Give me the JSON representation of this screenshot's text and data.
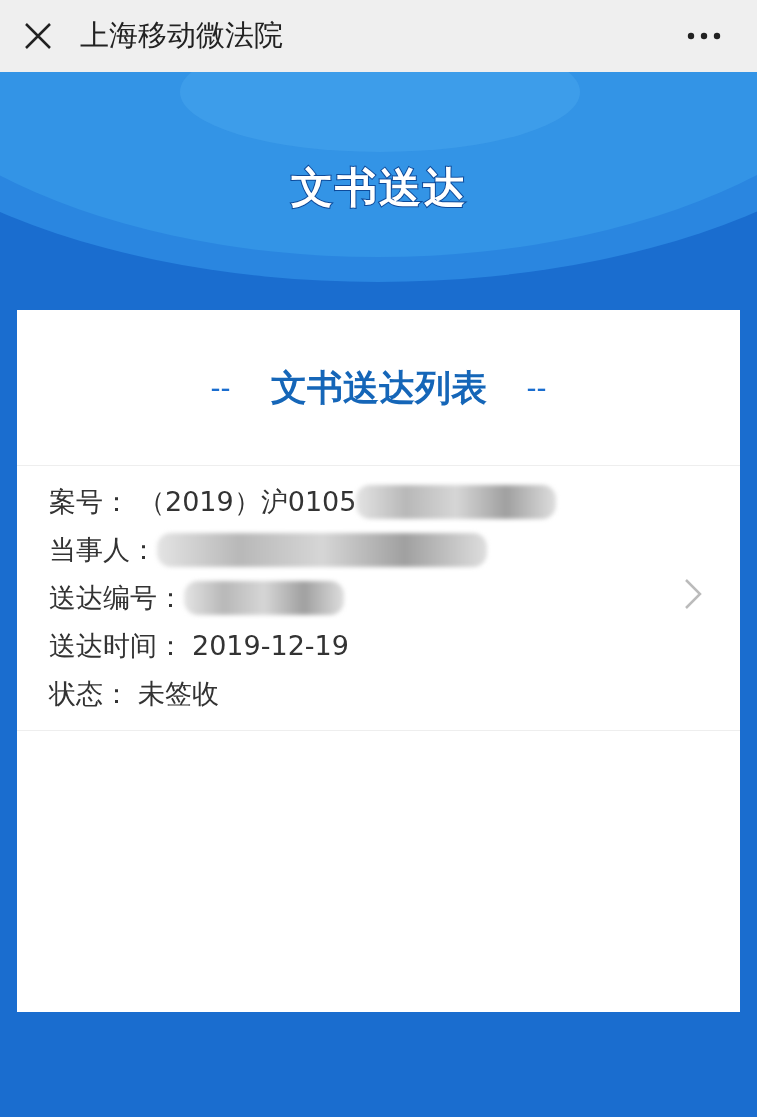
{
  "window": {
    "title": "上海移动微法院"
  },
  "banner": {
    "title": "文书送达"
  },
  "list": {
    "title": "文书送达列表",
    "dash_left": "--",
    "dash_right": "--",
    "items": [
      {
        "fields": [
          {
            "label": "案号：",
            "value": "（2019）沪0105",
            "redacted": true
          },
          {
            "label": "当事人：",
            "redacted": true
          },
          {
            "label": "送达编号：",
            "redacted": true
          },
          {
            "label": "送达时间：",
            "value": "2019-12-19",
            "redacted": false
          },
          {
            "label": "状态：",
            "value": "未签收",
            "redacted": false
          }
        ]
      }
    ]
  }
}
